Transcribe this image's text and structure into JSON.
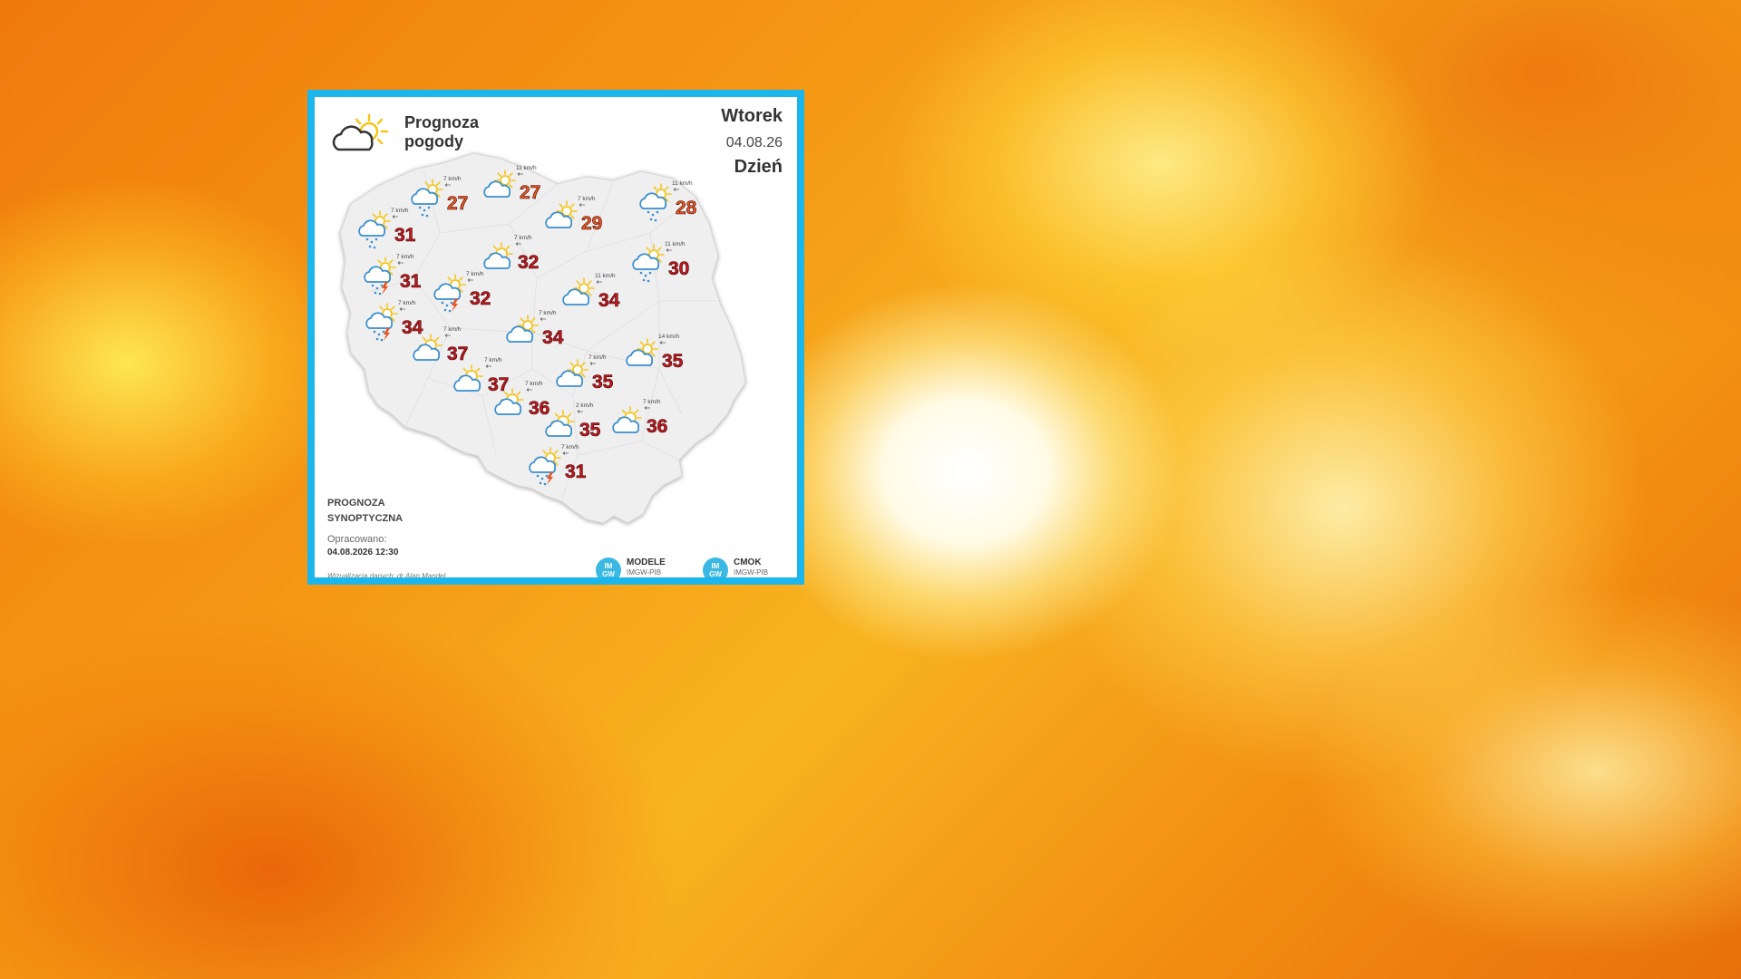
{
  "colors": {
    "frame": "#1bb6ec",
    "temp_hot": "#c1161d",
    "temp_warm": "#e8541e",
    "sun": "#f5c518",
    "cloud": "#3a8fd0",
    "rain": "#3a8fd0",
    "lightning": "#e8501e"
  },
  "card": {
    "title": "Prognoza\npogody",
    "day": "Wtorek",
    "date": "04.08.26",
    "period": "Dzień",
    "label": "PROGNOZA\nSYNOPTYCZNA",
    "made_label": "Opracowano:",
    "made_date": "04.08.2026 12:30",
    "credit": "Wizualizacja danych: dr Alan Mandel",
    "logos": [
      {
        "badge": "IM\nGW",
        "name": "MODELE",
        "sub": "IMGW-PIB"
      },
      {
        "badge": "IM\nGW",
        "name": "CMOK",
        "sub": "IMGW-PIB"
      }
    ]
  },
  "map_points": [
    {
      "temp": "27",
      "wind": "7 km/h",
      "icon": "cloud-rain-sun-icon"
    },
    {
      "temp": "27",
      "wind": "11 km/h",
      "icon": "cloud-sun-icon"
    },
    {
      "temp": "28",
      "wind": "11 km/h",
      "icon": "cloud-rain-sun-icon"
    },
    {
      "temp": "31",
      "wind": "7 km/h",
      "icon": "cloud-rain-sun-icon"
    },
    {
      "temp": "29",
      "wind": "7 km/h",
      "icon": "cloud-sun-icon"
    },
    {
      "temp": "32",
      "wind": "7 km/h",
      "icon": "sun-cloud-icon"
    },
    {
      "temp": "30",
      "wind": "11 km/h",
      "icon": "cloud-rain-sun-icon"
    },
    {
      "temp": "31",
      "wind": "7 km/h",
      "icon": "storm-icon"
    },
    {
      "temp": "32",
      "wind": "7 km/h",
      "icon": "storm-icon"
    },
    {
      "temp": "34",
      "wind": "11 km/h",
      "icon": "cloud-sun-icon"
    },
    {
      "temp": "34",
      "wind": "7 km/h",
      "icon": "storm-icon"
    },
    {
      "temp": "34",
      "wind": "7 km/h",
      "icon": "cloud-sun-icon"
    },
    {
      "temp": "37",
      "wind": "7 km/h",
      "icon": "sun-cloud-icon"
    },
    {
      "temp": "35",
      "wind": "14 km/h",
      "icon": "cloud-sun-icon"
    },
    {
      "temp": "37",
      "wind": "7 km/h",
      "icon": "sun-cloud-icon"
    },
    {
      "temp": "35",
      "wind": "7 km/h",
      "icon": "cloud-sun-icon"
    },
    {
      "temp": "36",
      "wind": "7 km/h",
      "icon": "sun-cloud-icon"
    },
    {
      "temp": "35",
      "wind": "2 km/h",
      "icon": "sun-cloud-icon"
    },
    {
      "temp": "36",
      "wind": "7 km/h",
      "icon": "sun-cloud-icon"
    },
    {
      "temp": "31",
      "wind": "7 km/h",
      "icon": "storm-icon"
    }
  ]
}
